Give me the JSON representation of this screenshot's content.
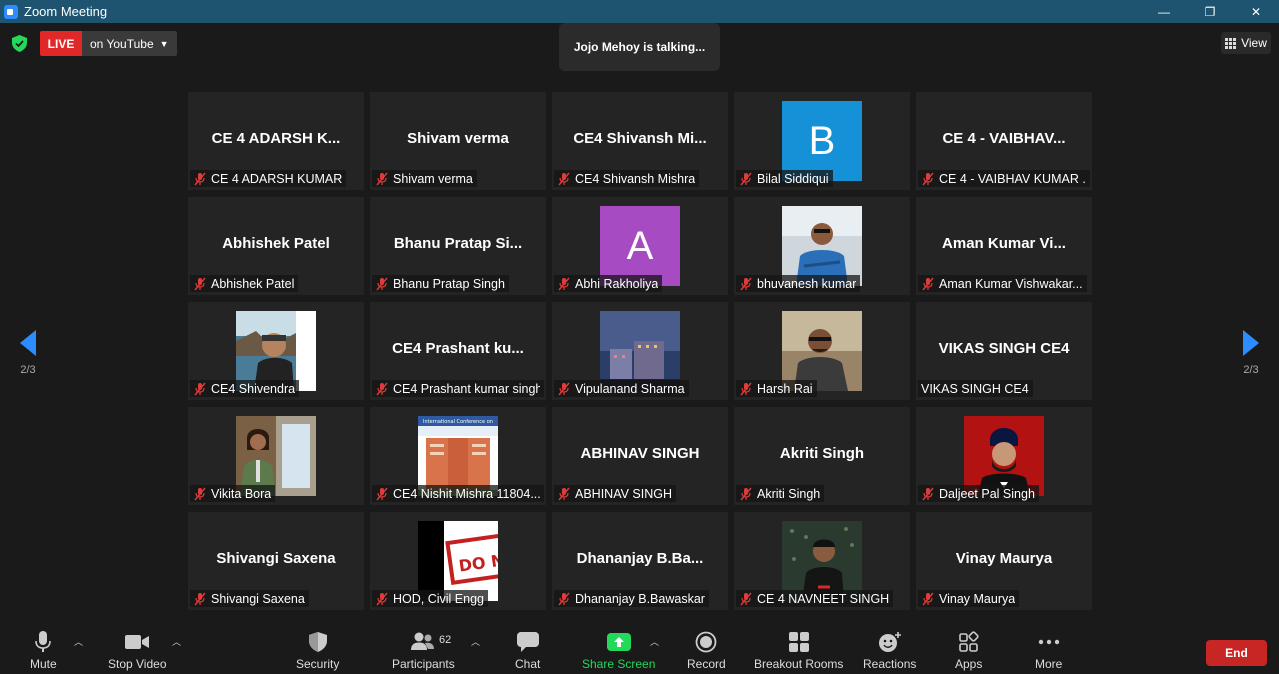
{
  "window": {
    "title": "Zoom Meeting",
    "minimize": "—",
    "maximize": "❐",
    "close": "✕"
  },
  "top": {
    "live_label": "LIVE",
    "live_destination": "on YouTube",
    "talking": "Jojo Mehoy is talking...",
    "view_label": "View"
  },
  "pagination": {
    "left": "2/3",
    "right": "2/3"
  },
  "tiles": [
    {
      "big": "CE 4  ADARSH  K...",
      "name": "CE 4 ADARSH KUMAR",
      "kind": "text"
    },
    {
      "big": "Shivam verma",
      "name": "Shivam verma",
      "kind": "text"
    },
    {
      "big": "CE4  Shivansh  Mi...",
      "name": "CE4 Shivansh Mishra",
      "kind": "text"
    },
    {
      "big": "B",
      "name": "Bilal Siddiqui",
      "kind": "avatar",
      "color": "#1591d8"
    },
    {
      "big": "CE 4  -  VAIBHAV...",
      "name": "CE 4 - VAIBHAV KUMAR ...",
      "kind": "text"
    },
    {
      "big": "Abhishek Patel",
      "name": "Abhishek Patel",
      "kind": "text"
    },
    {
      "big": "Bhanu  Pratap  Si...",
      "name": "Bhanu Pratap Singh",
      "kind": "text"
    },
    {
      "big": "A",
      "name": "Abhi Rakholiya",
      "kind": "avatar",
      "color": "#a74bc2"
    },
    {
      "big": "",
      "name": "bhuvanesh kumar",
      "kind": "photo",
      "photo": "bhuvanesh"
    },
    {
      "big": "Aman  Kumar  Vi...",
      "name": "Aman Kumar Vishwakar...",
      "kind": "text"
    },
    {
      "big": "",
      "name": "CE4 Shivendra",
      "kind": "photo",
      "photo": "shivendra"
    },
    {
      "big": "CE4  Prashant  ku...",
      "name": "CE4 Prashant kumar singh",
      "kind": "text"
    },
    {
      "big": "",
      "name": "Vipulanand Sharma",
      "kind": "photo",
      "photo": "vipulanand"
    },
    {
      "big": "",
      "name": "Harsh Rai",
      "kind": "photo",
      "photo": "harsh"
    },
    {
      "big": "VIKAS SINGH CE4",
      "name": "VIKAS SINGH CE4",
      "kind": "text",
      "unmuted": true
    },
    {
      "big": "",
      "name": "Vikita Bora",
      "kind": "photo",
      "photo": "vikita"
    },
    {
      "big": "",
      "name": "CE4 Nishit Mishra 11804...",
      "kind": "photo",
      "photo": "nishit"
    },
    {
      "big": "ABHINAV SINGH",
      "name": "ABHINAV SINGH",
      "kind": "text"
    },
    {
      "big": "Akriti Singh",
      "name": "Akriti Singh",
      "kind": "text"
    },
    {
      "big": "",
      "name": "Daljeet Pal Singh",
      "kind": "photo",
      "photo": "daljeet"
    },
    {
      "big": "Shivangi Saxena",
      "name": "Shivangi Saxena",
      "kind": "text"
    },
    {
      "big": "",
      "name": "HOD, Civil Engg",
      "kind": "photo",
      "photo": "hod"
    },
    {
      "big": "Dhananjay  B.Ba...",
      "name": "Dhananjay B.Bawaskar",
      "kind": "text"
    },
    {
      "big": "",
      "name": "CE 4 NAVNEET SINGH",
      "kind": "photo",
      "photo": "navneet"
    },
    {
      "big": "Vinay Maurya",
      "name": "Vinay Maurya",
      "kind": "text"
    }
  ],
  "photo_text": {
    "nishit_banner": "International Conference on",
    "hod_sign": "DO N"
  },
  "toolbar": {
    "mute": "Mute",
    "stop_video": "Stop Video",
    "security": "Security",
    "participants": "Participants",
    "participants_count": "62",
    "chat": "Chat",
    "share_screen": "Share Screen",
    "record": "Record",
    "breakout": "Breakout Rooms",
    "reactions": "Reactions",
    "apps": "Apps",
    "more": "More",
    "end": "End"
  },
  "colors": {
    "accent_green": "#23d959",
    "end_red": "#c82525",
    "live_red": "#e02828",
    "nav_blue": "#2d8cff"
  }
}
